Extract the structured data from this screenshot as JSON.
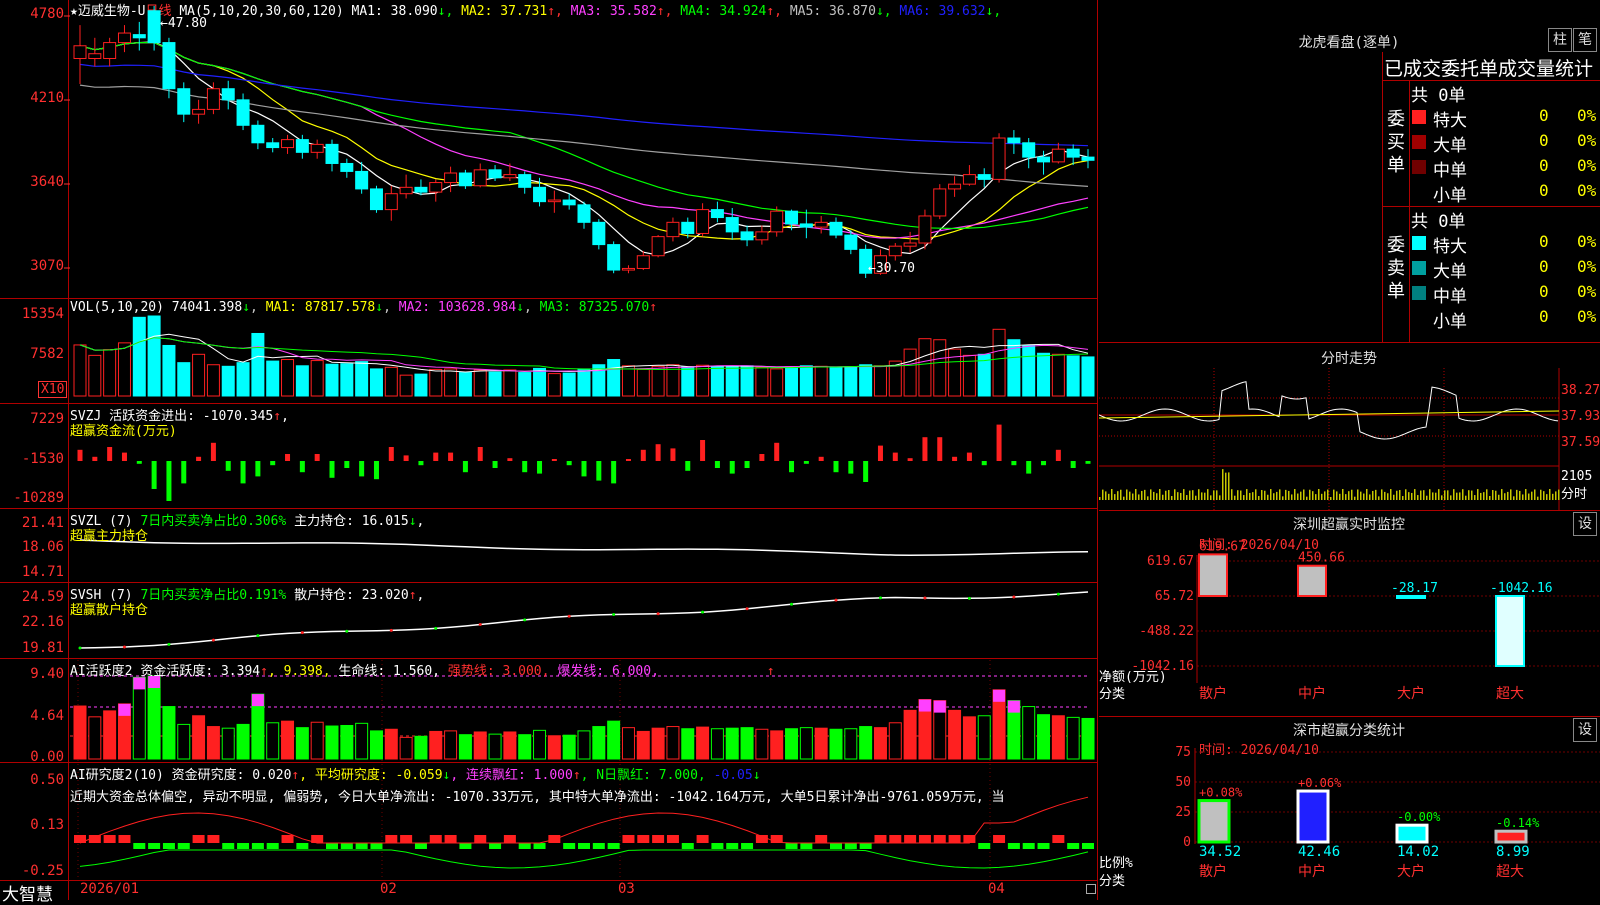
{
  "colors": {
    "up": "#ff2020",
    "down": "#00ffff",
    "grid": "#b00000",
    "yellow": "#ffff00",
    "magenta": "#ff40ff",
    "green": "#00ff00",
    "white": "#ffffff",
    "blue": "#2020ff",
    "gray": "#a0a0a0"
  },
  "header": {
    "star_title": "★迈威生物-U",
    "period": "日线",
    "ma_label": "MA(5,10,20,30,60,120)",
    "ma": [
      {
        "label": "MA1: 38.090",
        "arrow": "↓",
        "color": "#ffffff"
      },
      {
        "label": "MA2: 37.731",
        "arrow": "↑",
        "color": "#ffff00"
      },
      {
        "label": "MA3: 35.582",
        "arrow": "↑",
        "color": "#ff40ff"
      },
      {
        "label": "MA4: 34.924",
        "arrow": "↑",
        "color": "#00ff00"
      },
      {
        "label": "MA5: 36.870",
        "arrow": "↓",
        "color": "#c0c0c0"
      },
      {
        "label": "MA6: 39.632",
        "arrow": "↓",
        "color": "#2020ff"
      }
    ]
  },
  "price_axis": [
    "4780",
    "4210",
    "3640",
    "3070"
  ],
  "annotations": {
    "high": "47.80",
    "low": "30.70"
  },
  "vol": {
    "title": "VOL(5,10,20)",
    "value": "74041.398",
    "arrow": "↓",
    "ma1": "MA1: 87817.578",
    "ma1_arrow": "↓",
    "ma2": "MA2: 103628.984",
    "ma2_arrow": "↓",
    "ma3": "MA3: 87325.070",
    "ma3_arrow": "↑",
    "axis": [
      "15354",
      "7582"
    ],
    "unit": "X10"
  },
  "svzj": {
    "title": "SVZJ  活跃资金进出: -1070.345",
    "arrow": "↑",
    "tail": ",",
    "subtitle": "超赢资金流(万元)",
    "axis": [
      "7229",
      "-1530",
      "-10289"
    ]
  },
  "svzl": {
    "title": "SVZL (7)",
    "t2": "7日内买卖净占比0.306%",
    "t3": "主力持仓: 16.015",
    "arrow": "↓",
    "tail": ",",
    "subtitle": "超赢主力持仓",
    "axis": [
      "21.41",
      "18.06",
      "14.71"
    ]
  },
  "svsh": {
    "title": "SVSH (7)",
    "t2": "7日内买卖净占比0.191%",
    "t3": "散户持仓: 23.020",
    "arrow": "↑",
    "tail": ",",
    "subtitle": "超赢散户持仓",
    "axis": [
      "24.59",
      "22.16",
      "19.81"
    ]
  },
  "ai1": {
    "title": "AI活跃度2",
    "t2": "资金活跃度: 3.394",
    "a2": "↑",
    "t3": ", 9.398,",
    "t4": "生命线: 1.560,",
    "t5": "强势线: 3.000,",
    "t6": "爆发线: 6.000,",
    "t7": "↑",
    "axis": [
      "9.40",
      "4.64",
      "0.00"
    ]
  },
  "ai2": {
    "title": "AI研究度2(10)",
    "t2": "资金研究度: 0.020",
    "a2": "↑",
    "t3": ", 平均研究度: -0.059",
    "a3": "↓",
    "t4": ", 连续飘红: 1.000",
    "a4": "↑",
    "t5": ", N日飘红: 7.000,",
    "t6": "-0.05",
    "a6": "↓",
    "note": "近期大资金总体偏空, 异动不明显, 偏弱势, 今日大单净流出: -1070.33万元, 其中特大单净流出: -1042.164万元, 大单5日累计净出-9761.059万元, 当",
    "axis": [
      "0.50",
      "0.13",
      "-0.25"
    ]
  },
  "dates": [
    "2026/01",
    "02",
    "03",
    "04"
  ],
  "brand": "大智慧",
  "sidebar": {
    "lhb_title": "龙虎看盘(逐单)",
    "btn_zhu": "柱",
    "btn_bi": "笔",
    "tabs": "已成交委托单成交量统计",
    "buy": {
      "label": "委买单",
      "total": "共 0单",
      "rows": [
        {
          "name": "特大",
          "qty": "0",
          "pct": "0%",
          "color": "#ff2020"
        },
        {
          "name": "大单",
          "qty": "0",
          "pct": "0%",
          "color": "#a00000"
        },
        {
          "name": "中单",
          "qty": "0",
          "pct": "0%",
          "color": "#700000"
        },
        {
          "name": "小单",
          "qty": "0",
          "pct": "0%",
          "color": "#000000"
        }
      ]
    },
    "sell": {
      "label": "委卖单",
      "total": "共 0单",
      "rows": [
        {
          "name": "特大",
          "qty": "0",
          "pct": "0%",
          "color": "#00ffff"
        },
        {
          "name": "大单",
          "qty": "0",
          "pct": "0%",
          "color": "#00a0a0"
        },
        {
          "name": "中单",
          "qty": "0",
          "pct": "0%",
          "color": "#008080"
        },
        {
          "name": "小单",
          "qty": "0",
          "pct": "0%",
          "color": "#000000"
        }
      ]
    },
    "fenshi": {
      "title": "分时走势",
      "axis": [
        "38.27",
        "37.93",
        "37.59"
      ],
      "vol_axis": [
        "2105",
        "分时"
      ]
    },
    "monitor": {
      "title": "深圳超赢实时监控",
      "btn": "设",
      "time": "时间: 2026/04/10",
      "axis": [
        "619.67",
        "65.72",
        "-488.22",
        "-1042.16"
      ],
      "unit": "净额(万元)",
      "cat_label": "分类",
      "values": [
        {
          "cat": "散户",
          "val": 619.67,
          "label": "619.67"
        },
        {
          "cat": "中户",
          "val": 450.66,
          "label": "450.66"
        },
        {
          "cat": "大户",
          "val": -28.17,
          "label": "-28.17"
        },
        {
          "cat": "超大",
          "val": -1042.16,
          "label": "-1042.16"
        }
      ]
    },
    "stats": {
      "title": "深市超赢分类统计",
      "btn": "设",
      "time": "时间: 2026/04/10",
      "axis": [
        "75",
        "50",
        "25",
        "0"
      ],
      "unit": "比例%",
      "cat_label": "分类",
      "values": [
        {
          "cat": "散户",
          "val": 34.52,
          "label": "34.52",
          "chg": "+0.08%"
        },
        {
          "cat": "中户",
          "val": 42.46,
          "label": "42.46",
          "chg": "+0.06%"
        },
        {
          "cat": "大户",
          "val": 14.02,
          "label": "14.02",
          "chg": "-0.00%"
        },
        {
          "cat": "超大",
          "val": 8.99,
          "label": "8.99",
          "chg": "-0.14%"
        }
      ]
    }
  },
  "chart_data": {
    "type": "candlestick",
    "title": "迈威生物-U 日线",
    "ylim": [
      28.5,
      48.5
    ],
    "x": [
      "2026/01",
      "02",
      "03",
      "04"
    ],
    "ohlc": [
      [
        44.5,
        46.6,
        42.9,
        45.3
      ],
      [
        44.5,
        45.8,
        44.0,
        44.8
      ],
      [
        44.5,
        45.8,
        44.0,
        45.5
      ],
      [
        45.5,
        46.6,
        44.9,
        46.1
      ],
      [
        46.0,
        46.8,
        45.0,
        45.8
      ],
      [
        47.5,
        47.8,
        45.0,
        45.5
      ],
      [
        45.5,
        45.8,
        42.0,
        42.6
      ],
      [
        42.6,
        43.0,
        40.5,
        41.0
      ],
      [
        41.0,
        41.9,
        40.4,
        41.3
      ],
      [
        41.3,
        43.0,
        41.0,
        42.6
      ],
      [
        42.6,
        43.1,
        41.3,
        41.9
      ],
      [
        41.9,
        42.3,
        40.0,
        40.3
      ],
      [
        40.3,
        40.6,
        38.8,
        39.2
      ],
      [
        39.2,
        39.5,
        38.6,
        38.9
      ],
      [
        38.9,
        39.7,
        38.5,
        39.4
      ],
      [
        39.4,
        39.7,
        38.2,
        38.6
      ],
      [
        38.6,
        39.4,
        38.2,
        39.1
      ],
      [
        39.1,
        39.4,
        37.4,
        37.9
      ],
      [
        37.9,
        38.2,
        37.0,
        37.4
      ],
      [
        37.4,
        38.0,
        36.0,
        36.3
      ],
      [
        36.3,
        36.5,
        34.8,
        35.0
      ],
      [
        35.0,
        36.5,
        34.3,
        36.0
      ],
      [
        36.0,
        37.2,
        35.7,
        36.4
      ],
      [
        36.4,
        36.9,
        35.9,
        36.1
      ],
      [
        36.1,
        36.9,
        35.5,
        36.7
      ],
      [
        36.7,
        37.7,
        36.1,
        37.3
      ],
      [
        37.3,
        37.5,
        36.3,
        36.5
      ],
      [
        36.5,
        37.9,
        36.4,
        37.5
      ],
      [
        37.5,
        37.8,
        36.8,
        37.0
      ],
      [
        37.0,
        37.9,
        36.8,
        37.2
      ],
      [
        37.2,
        37.4,
        36.0,
        36.4
      ],
      [
        36.4,
        37.0,
        35.2,
        35.5
      ],
      [
        35.5,
        36.2,
        34.8,
        35.6
      ],
      [
        35.6,
        36.0,
        35.0,
        35.3
      ],
      [
        35.3,
        35.5,
        33.8,
        34.2
      ],
      [
        34.2,
        34.4,
        32.5,
        32.8
      ],
      [
        32.8,
        33.0,
        31.0,
        31.2
      ],
      [
        31.2,
        31.5,
        31.0,
        31.3
      ],
      [
        31.3,
        32.4,
        31.2,
        32.1
      ],
      [
        32.1,
        33.4,
        32.0,
        33.3
      ],
      [
        33.3,
        34.5,
        33.0,
        34.2
      ],
      [
        34.2,
        34.5,
        33.2,
        33.5
      ],
      [
        33.5,
        35.4,
        33.3,
        35.0
      ],
      [
        35.0,
        35.5,
        34.2,
        34.5
      ],
      [
        34.5,
        35.1,
        33.1,
        33.6
      ],
      [
        33.6,
        34.0,
        32.7,
        33.1
      ],
      [
        33.1,
        34.0,
        32.8,
        33.6
      ],
      [
        33.6,
        35.2,
        33.3,
        34.9
      ],
      [
        34.9,
        35.0,
        33.7,
        34.1
      ],
      [
        34.1,
        35.0,
        33.2,
        33.9
      ],
      [
        33.9,
        34.6,
        33.5,
        34.2
      ],
      [
        34.2,
        34.5,
        33.2,
        33.4
      ],
      [
        33.4,
        33.7,
        32.2,
        32.5
      ],
      [
        32.5,
        32.8,
        30.7,
        31.0
      ],
      [
        31.0,
        32.5,
        30.9,
        32.1
      ],
      [
        32.1,
        32.9,
        31.8,
        32.7
      ],
      [
        32.7,
        33.6,
        32.3,
        32.9
      ],
      [
        32.9,
        35.0,
        32.5,
        34.6
      ],
      [
        34.6,
        36.6,
        34.4,
        36.3
      ],
      [
        36.3,
        37.1,
        35.8,
        36.6
      ],
      [
        36.6,
        37.8,
        36.5,
        37.2
      ],
      [
        37.2,
        37.6,
        36.4,
        36.9
      ],
      [
        36.9,
        39.8,
        36.7,
        39.5
      ],
      [
        39.5,
        40.0,
        38.5,
        39.2
      ],
      [
        39.2,
        39.5,
        37.6,
        38.3
      ],
      [
        38.3,
        38.7,
        37.2,
        38.0
      ],
      [
        38.0,
        39.2,
        37.9,
        38.8
      ],
      [
        38.8,
        39.1,
        37.8,
        38.3
      ],
      [
        38.3,
        38.8,
        37.6,
        38.1
      ]
    ],
    "volume": [
      9800,
      7800,
      8900,
      10200,
      15100,
      15354,
      9700,
      6400,
      8000,
      6000,
      5700,
      6400,
      12000,
      6700,
      7000,
      5800,
      6800,
      6100,
      6200,
      6600,
      5200,
      5500,
      4000,
      4200,
      5100,
      5200,
      4500,
      5000,
      4600,
      5000,
      4500,
      5300,
      4300,
      4400,
      5200,
      6000,
      7000,
      5800,
      5100,
      5700,
      6000,
      5600,
      5900,
      5600,
      5700,
      5800,
      5500,
      5200,
      5600,
      5800,
      5700,
      5500,
      5600,
      6000,
      5800,
      6700,
      9000,
      11000,
      10800,
      9000,
      7800,
      8000,
      12800,
      10800,
      9700,
      8200,
      8000,
      7700,
      7500
    ],
    "series": [
      {
        "name": "MA1",
        "color": "#ffffff"
      },
      {
        "name": "MA2",
        "color": "#ffff00"
      },
      {
        "name": "MA3",
        "color": "#ff40ff"
      },
      {
        "name": "MA4",
        "color": "#00ff00"
      },
      {
        "name": "MA5",
        "color": "#c0c0c0"
      },
      {
        "name": "MA6",
        "color": "#2020ff"
      }
    ]
  }
}
